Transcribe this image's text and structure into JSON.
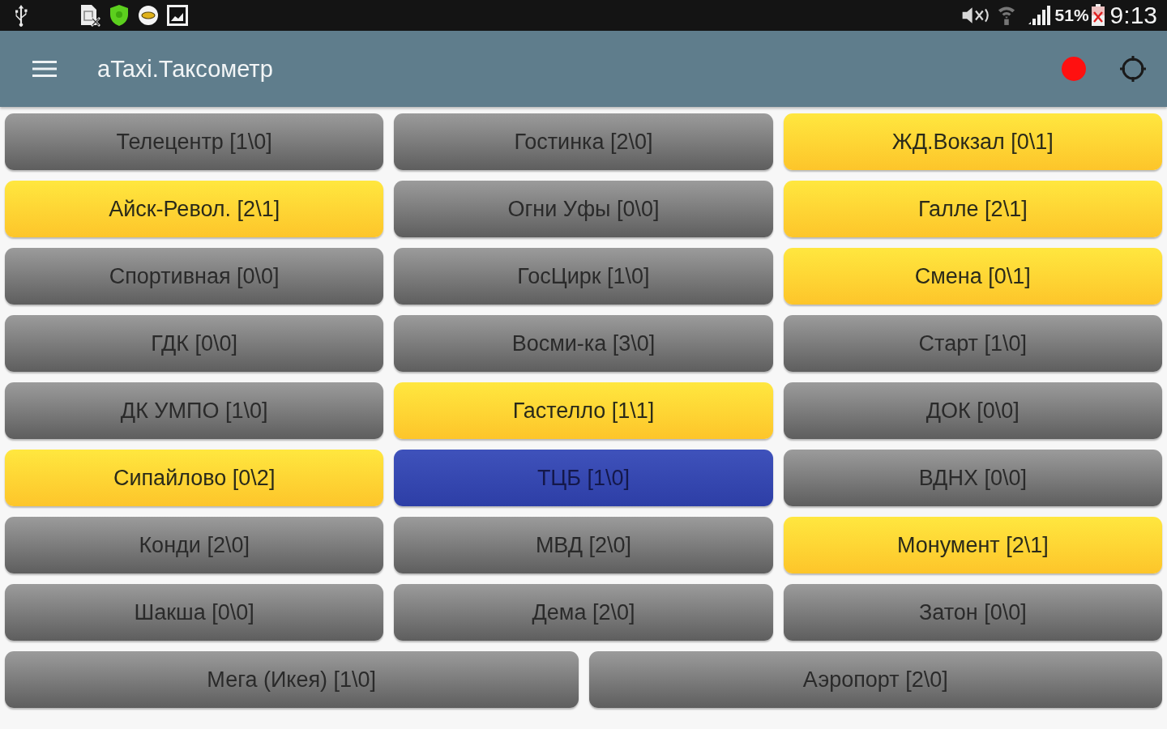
{
  "status_bar": {
    "battery": "51%",
    "time": "9:13"
  },
  "app_bar": {
    "title": "aTaxi.Таксометр"
  },
  "grid": {
    "rows": [
      {
        "buttons": [
          {
            "label": "Телецентр [1\\0]",
            "highlighted": false,
            "selected": false
          },
          {
            "label": "Гостинка [2\\0]",
            "highlighted": false,
            "selected": false
          },
          {
            "label": "ЖД.Вокзал [0\\1]",
            "highlighted": true,
            "selected": false
          }
        ]
      },
      {
        "buttons": [
          {
            "label": "Айск-Револ. [2\\1]",
            "highlighted": true,
            "selected": false
          },
          {
            "label": "Огни Уфы [0\\0]",
            "highlighted": false,
            "selected": false
          },
          {
            "label": "Галле [2\\1]",
            "highlighted": true,
            "selected": false
          }
        ]
      },
      {
        "buttons": [
          {
            "label": "Спортивная [0\\0]",
            "highlighted": false,
            "selected": false
          },
          {
            "label": "ГосЦирк [1\\0]",
            "highlighted": false,
            "selected": false
          },
          {
            "label": "Смена [0\\1]",
            "highlighted": true,
            "selected": false
          }
        ]
      },
      {
        "buttons": [
          {
            "label": "ГДК [0\\0]",
            "highlighted": false,
            "selected": false
          },
          {
            "label": "Восми-ка [3\\0]",
            "highlighted": false,
            "selected": false
          },
          {
            "label": "Старт [1\\0]",
            "highlighted": false,
            "selected": false
          }
        ]
      },
      {
        "buttons": [
          {
            "label": "ДК УМПО [1\\0]",
            "highlighted": false,
            "selected": false
          },
          {
            "label": "Гастелло [1\\1]",
            "highlighted": true,
            "selected": false
          },
          {
            "label": "ДОК [0\\0]",
            "highlighted": false,
            "selected": false
          }
        ]
      },
      {
        "buttons": [
          {
            "label": "Сипайлово [0\\2]",
            "highlighted": true,
            "selected": false
          },
          {
            "label": "ТЦБ [1\\0]",
            "highlighted": false,
            "selected": true
          },
          {
            "label": "ВДНХ [0\\0]",
            "highlighted": false,
            "selected": false
          }
        ]
      },
      {
        "buttons": [
          {
            "label": "Конди [2\\0]",
            "highlighted": false,
            "selected": false
          },
          {
            "label": "МВД [2\\0]",
            "highlighted": false,
            "selected": false
          },
          {
            "label": "Монумент [2\\1]",
            "highlighted": true,
            "selected": false
          }
        ]
      },
      {
        "buttons": [
          {
            "label": "Шакша [0\\0]",
            "highlighted": false,
            "selected": false
          },
          {
            "label": "Дема [2\\0]",
            "highlighted": false,
            "selected": false
          },
          {
            "label": "Затон [0\\0]",
            "highlighted": false,
            "selected": false
          }
        ]
      },
      {
        "buttons": [
          {
            "label": "Мега (Икея) [1\\0]",
            "highlighted": false,
            "selected": false
          },
          {
            "label": "Аэропорт [2\\0]",
            "highlighted": false,
            "selected": false
          }
        ]
      }
    ]
  }
}
